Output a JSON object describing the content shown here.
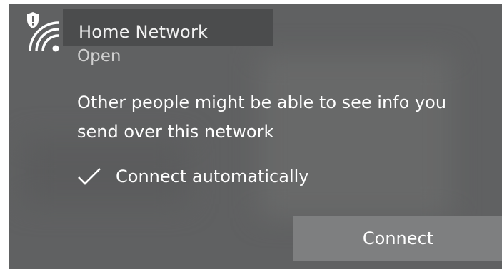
{
  "network": {
    "ssid": "Home Network",
    "security": "Open",
    "warning": "Other people might be able to see info you send over this network",
    "auto_connect_label": "Connect automatically",
    "auto_connect_checked": true,
    "connect_label": "Connect",
    "icon": "wifi-warning-icon"
  },
  "colors": {
    "panel_bg": "#606162",
    "button_bg": "#7e7f80",
    "text": "#ffffff",
    "secondary_text": "#cfcfcf"
  }
}
